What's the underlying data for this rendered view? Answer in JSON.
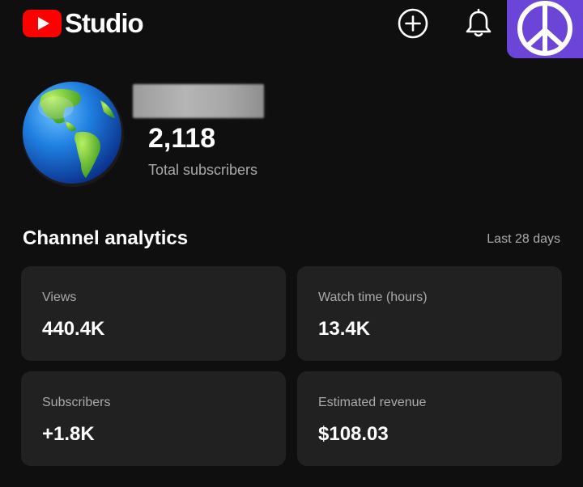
{
  "header": {
    "brand": "Studio",
    "create_icon": "add-circle-icon",
    "notifications_icon": "bell-icon",
    "account_icon": "peace-sign-avatar"
  },
  "channel": {
    "avatar": "globe-image",
    "subscriber_count": "2,118",
    "subscriber_label": "Total subscribers"
  },
  "analytics": {
    "title": "Channel analytics",
    "period": "Last 28 days",
    "cards": [
      {
        "label": "Views",
        "value": "440.4K"
      },
      {
        "label": "Watch time (hours)",
        "value": "13.4K"
      },
      {
        "label": "Subscribers",
        "value": "+1.8K"
      },
      {
        "label": "Estimated revenue",
        "value": "$108.03"
      }
    ]
  },
  "colors": {
    "background": "#0f0f0f",
    "card": "#212121",
    "youtube_red": "#ff0000",
    "avatar_purple": "#6b45d8",
    "secondary_text": "#aaaaaa"
  }
}
